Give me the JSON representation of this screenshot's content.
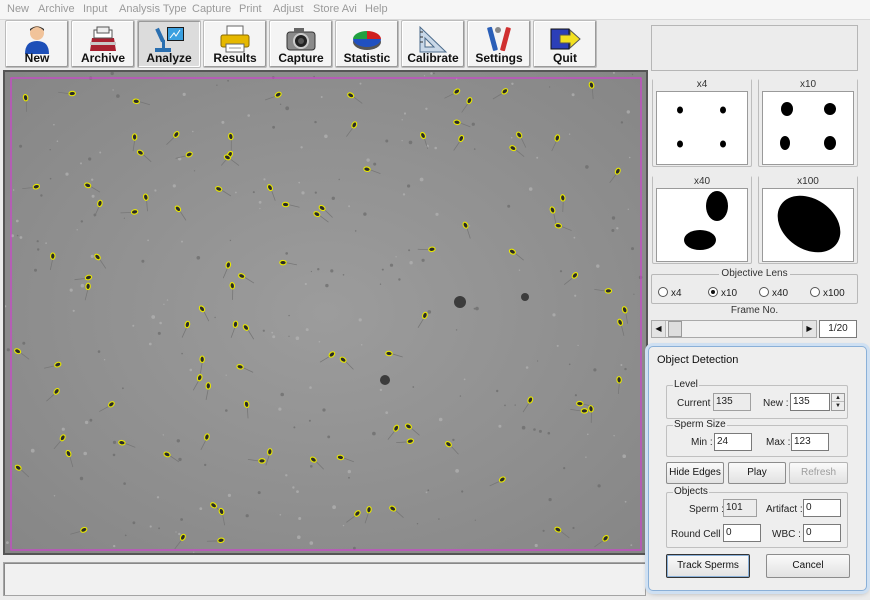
{
  "menu": [
    "New",
    "Archive",
    "Input",
    "Analysis Type",
    "Capture",
    "Print",
    "Adjust",
    "Store Avi",
    "Help"
  ],
  "toolbar": {
    "buttons": [
      {
        "label": "New",
        "icon": "user-icon"
      },
      {
        "label": "Archive",
        "icon": "archive-icon"
      },
      {
        "label": "Analyze",
        "icon": "microscope-icon"
      },
      {
        "label": "Results",
        "icon": "printer-icon"
      },
      {
        "label": "Capture",
        "icon": "camera-icon"
      },
      {
        "label": "Statistic",
        "icon": "pie-chart-icon"
      },
      {
        "label": "Calibrate",
        "icon": "triangle-ruler-icon"
      },
      {
        "label": "Settings",
        "icon": "tools-icon"
      },
      {
        "label": "Quit",
        "icon": "exit-icon"
      }
    ]
  },
  "lens_previews": [
    "x4",
    "x10",
    "x40",
    "x100"
  ],
  "objective_lens": {
    "title": "Objective Lens",
    "options": [
      "x4",
      "x10",
      "x40",
      "x100"
    ],
    "selected": "x10"
  },
  "frame": {
    "title": "Frame No.",
    "counter": "1/20"
  },
  "object_detection": {
    "title": "Object Detection",
    "level": {
      "title": "Level",
      "current_label": "Current :",
      "current": "135",
      "new_label": "New :",
      "new": "135"
    },
    "sperm_size": {
      "title": "Sperm Size",
      "min_label": "Min :",
      "min": "24",
      "max_label": "Max :",
      "max": "123"
    },
    "buttons": {
      "hide_edges": "Hide Edges",
      "play": "Play",
      "refresh": "Refresh",
      "track": "Track Sperms",
      "cancel": "Cancel"
    },
    "objects": {
      "title": "Objects",
      "sperm_label": "Sperm :",
      "sperm": "101",
      "artifact_label": "Artifact :",
      "artifact": "0",
      "round_cell_label": "Round Cell :",
      "round_cell": "0",
      "wbc_label": "WBC :",
      "wbc": "0"
    }
  },
  "colors": {
    "detection_border": "#d040d0",
    "sperm_marker": "#e8e800",
    "background": "#ececec"
  }
}
